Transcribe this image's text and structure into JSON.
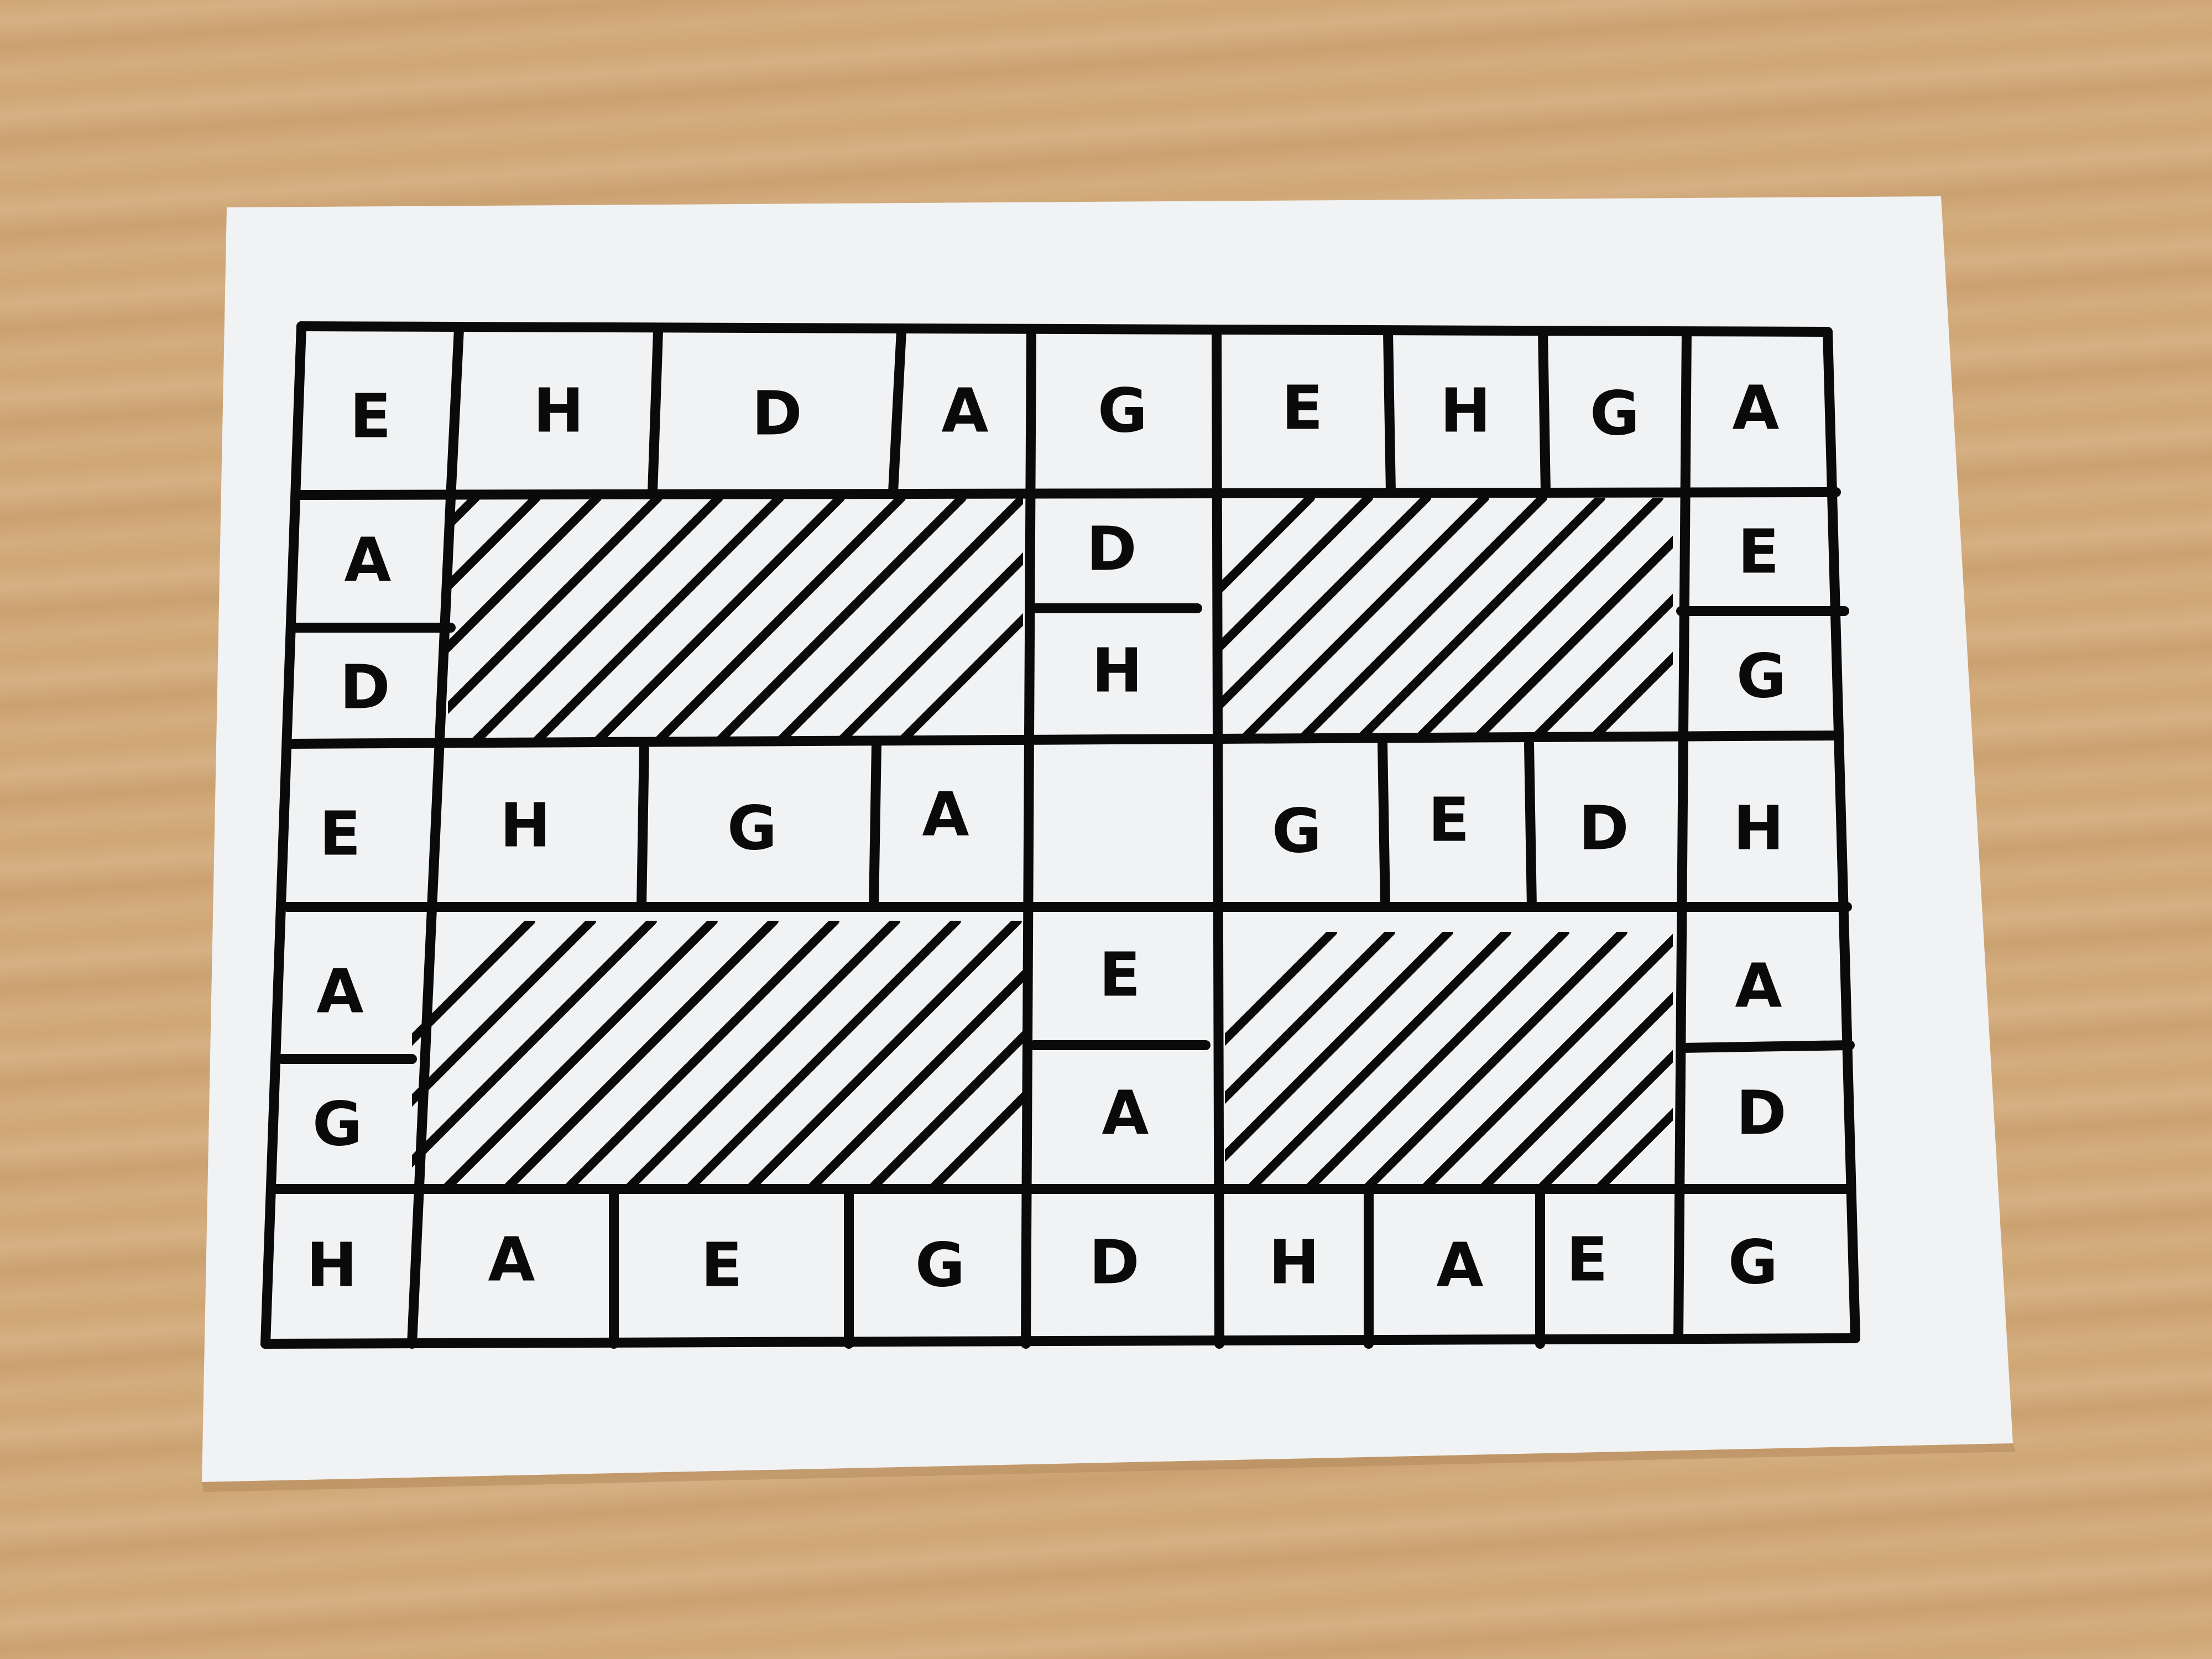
{
  "board": {
    "row1": [
      "E",
      "H",
      "D",
      "A",
      "G",
      "E",
      "H",
      "G",
      "A"
    ],
    "left_column": [
      "A",
      "D",
      "E",
      "A",
      "G"
    ],
    "right_column": [
      "E",
      "G",
      "H",
      "A",
      "D"
    ],
    "row4_left": [
      "H",
      "G",
      "A"
    ],
    "row4_right": [
      "G",
      "E",
      "D"
    ],
    "center_upper": [
      "D",
      "H"
    ],
    "center_lower": [
      "E",
      "A"
    ],
    "row7": [
      "H",
      "A",
      "E",
      "G",
      "D",
      "H",
      "A",
      "E",
      "G"
    ]
  },
  "colors": {
    "table": "#d1aa7a",
    "paper": "#f1f2f4",
    "ink": "#0a0a0a"
  }
}
